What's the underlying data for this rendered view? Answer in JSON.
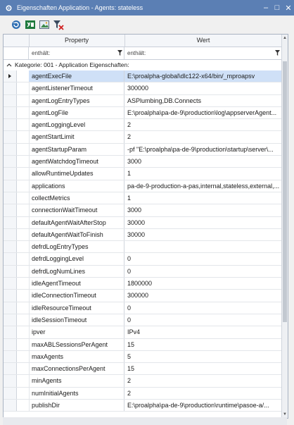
{
  "window": {
    "title": "Eigenschaften Application - Agents: stateless",
    "minimize": "–",
    "maximize": "□",
    "close": "✕"
  },
  "toolbar": {
    "buttons": [
      "refresh-icon",
      "excel-icon",
      "image-export-icon",
      "clear-filter-icon"
    ]
  },
  "grid": {
    "columns": {
      "property": "Property",
      "value": "Wert"
    },
    "filters": {
      "property": "enthält:",
      "value": "enthält:"
    },
    "category": "Kategorie: 001 - Application Eigenschaften:",
    "rows": [
      {
        "p": "agentExecFile",
        "v": "E:\\proalpha-global\\dlc122-x64/bin/_mproapsv"
      },
      {
        "p": "agentListenerTimeout",
        "v": "300000"
      },
      {
        "p": "agentLogEntryTypes",
        "v": "ASPlumbing,DB.Connects"
      },
      {
        "p": "agentLogFile",
        "v": "E:\\proalpha\\pa-de-9\\production\\log\\appserverAgent..."
      },
      {
        "p": "agentLoggingLevel",
        "v": "2"
      },
      {
        "p": "agentStartLimit",
        "v": "2"
      },
      {
        "p": "agentStartupParam",
        "v": "-pf \"E:\\proalpha\\pa-de-9\\production\\startup\\server\\..."
      },
      {
        "p": "agentWatchdogTimeout",
        "v": "3000"
      },
      {
        "p": "allowRuntimeUpdates",
        "v": "1"
      },
      {
        "p": "applications",
        "v": "pa-de-9-production-a-pas,internal,stateless,external,..."
      },
      {
        "p": "collectMetrics",
        "v": "1"
      },
      {
        "p": "connectionWaitTimeout",
        "v": "3000"
      },
      {
        "p": "defaultAgentWaitAfterStop",
        "v": "30000"
      },
      {
        "p": "defaultAgentWaitToFinish",
        "v": "30000"
      },
      {
        "p": "defrdLogEntryTypes",
        "v": ""
      },
      {
        "p": "defrdLoggingLevel",
        "v": "0"
      },
      {
        "p": "defrdLogNumLines",
        "v": "0"
      },
      {
        "p": "idleAgentTimeout",
        "v": "1800000"
      },
      {
        "p": "idleConnectionTimeout",
        "v": "300000"
      },
      {
        "p": "idleResourceTimeout",
        "v": "0"
      },
      {
        "p": "idleSessionTimeout",
        "v": "0"
      },
      {
        "p": "ipver",
        "v": "IPv4"
      },
      {
        "p": "maxABLSessionsPerAgent",
        "v": "15"
      },
      {
        "p": "maxAgents",
        "v": "5"
      },
      {
        "p": "maxConnectionsPerAgent",
        "v": "15"
      },
      {
        "p": "minAgents",
        "v": "2"
      },
      {
        "p": "numInitialAgents",
        "v": "2"
      },
      {
        "p": "publishDir",
        "v": "E:\\proalpha\\pa-de-9\\production\\runtime\\pasoe-a/..."
      }
    ]
  },
  "colors": {
    "titlebar": "#5b7fb4",
    "selection": "#cfe0f7"
  }
}
